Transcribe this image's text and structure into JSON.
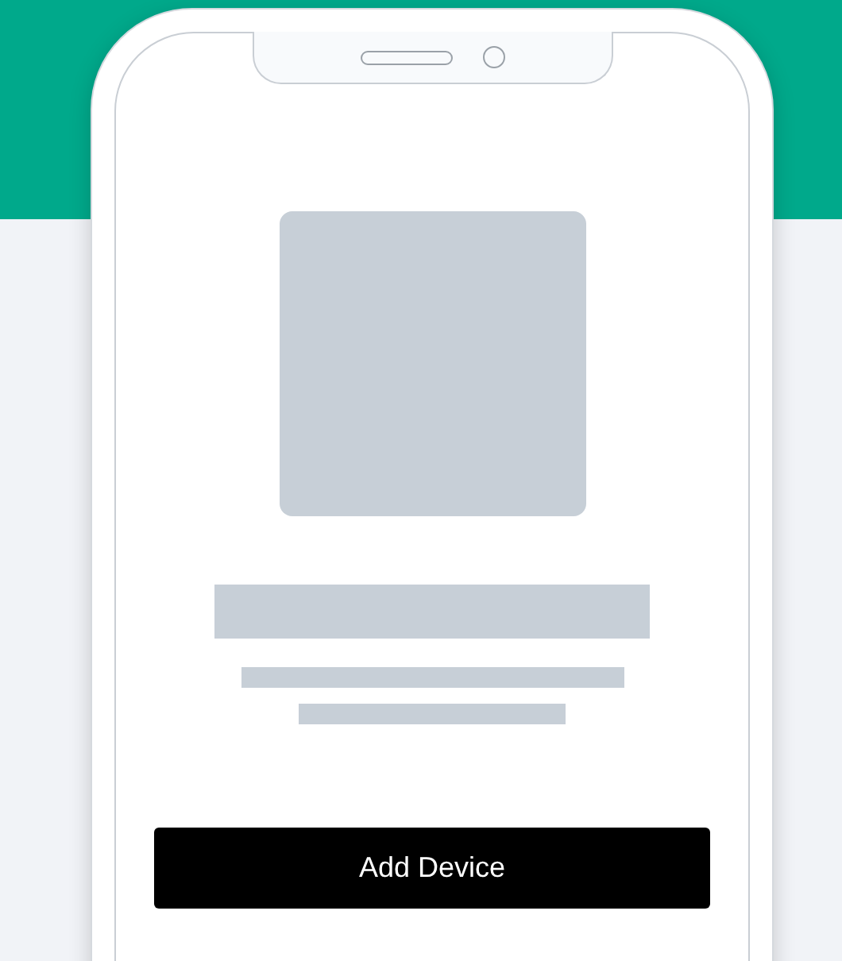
{
  "button": {
    "label": "Add Device"
  }
}
